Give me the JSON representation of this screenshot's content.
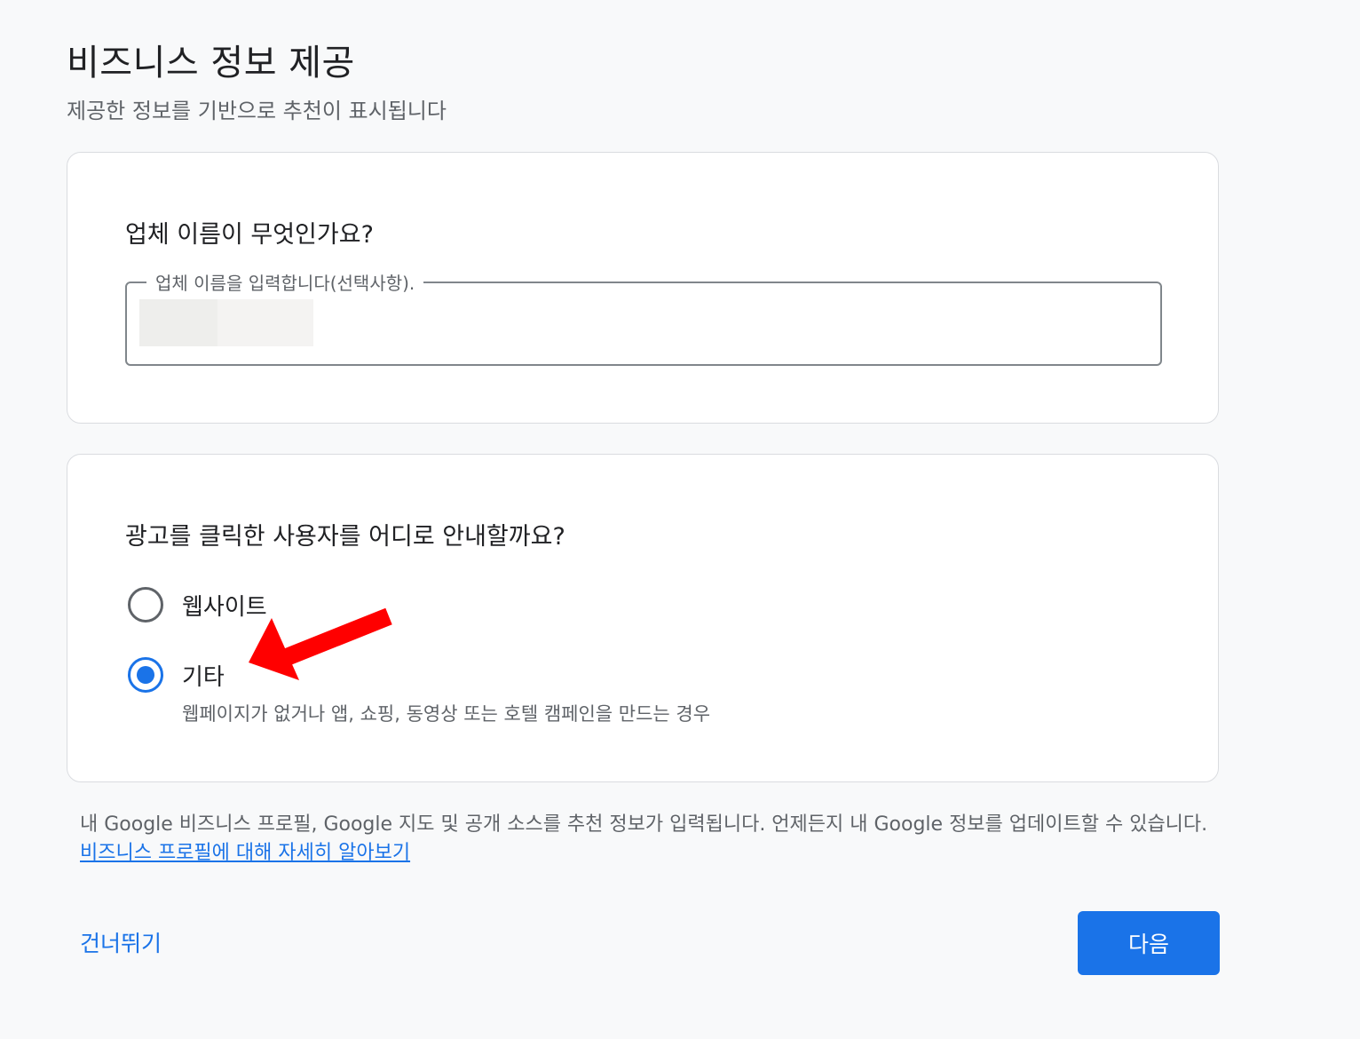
{
  "header": {
    "title": "비즈니스 정보 제공",
    "subtitle": "제공한 정보를 기반으로 추천이 표시됩니다"
  },
  "business_name": {
    "question": "업체 이름이 무엇인가요?",
    "field_label": "업체 이름을 입력합니다(선택사항).",
    "value": ""
  },
  "destination": {
    "question": "광고를 클릭한 사용자를 어디로 안내할까요?",
    "options": [
      {
        "label": "웹사이트",
        "selected": false
      },
      {
        "label": "기타",
        "selected": true,
        "description": "웹페이지가 없거나 앱, 쇼핑, 동영상 또는 호텔 캠페인을 만드는 경우"
      }
    ]
  },
  "footnote": {
    "text": "내 Google 비즈니스 프로필, Google 지도 및 공개 소스를 추천 정보가 입력됩니다. 언제든지 내 Google 정보를 업데이트할 수 있습니다. ",
    "link_text": "비즈니스 프로필에 대해 자세히 알아보기"
  },
  "actions": {
    "skip_label": "건너뛰기",
    "next_label": "다음"
  },
  "colors": {
    "accent": "#1a73e8",
    "annotation_arrow": "#ff0000"
  },
  "icons": {
    "annotation": "red-arrow-icon"
  }
}
